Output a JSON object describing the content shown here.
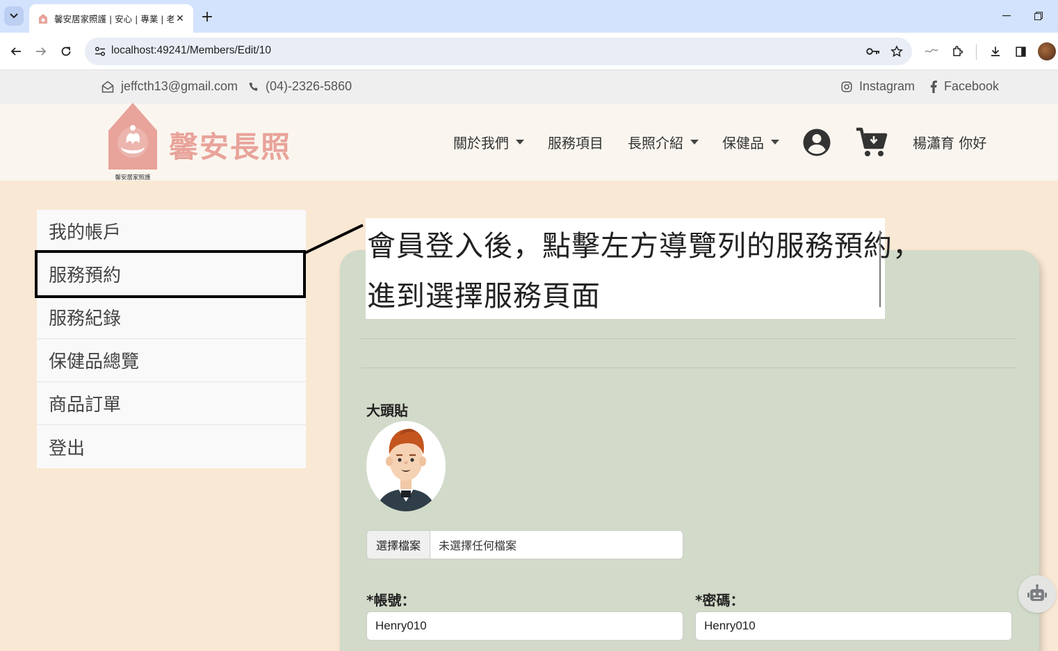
{
  "browser": {
    "tab_title": "馨安居家照護 | 安心 | 專業 | 老人",
    "url": "localhost:49241/Members/Edit/10"
  },
  "topbar": {
    "email": "jeffcth13@gmail.com",
    "phone": "(04)-2326-5860",
    "instagram": "Instagram",
    "facebook": "Facebook"
  },
  "header": {
    "brand": "馨安長照",
    "logo_caption": "馨安居家照護",
    "nav": {
      "about": "關於我們",
      "services": "服務項目",
      "ltc_intro": "長照介紹",
      "health_products": "保健品"
    },
    "greeting": "楊瀟育 你好"
  },
  "sidebar": {
    "items": [
      {
        "label": "我的帳戶"
      },
      {
        "label": "服務預約"
      },
      {
        "label": "服務紀錄"
      },
      {
        "label": "保健品總覽"
      },
      {
        "label": "商品訂單"
      },
      {
        "label": "登出"
      }
    ]
  },
  "callout": {
    "line1": "會員登入後，點擊左方導覽列的服務預約，",
    "line2": "進到選擇服務頁面"
  },
  "form": {
    "avatar_label": "大頭貼",
    "file_button": "選擇檔案",
    "file_status": "未選擇任何檔案",
    "account_label": "*帳號：",
    "account_value": "Henry010",
    "password_label": "*密碼：",
    "password_value": "Henry010"
  },
  "colors": {
    "page_bg": "#f9e8d4",
    "panel_bg": "#d2dac9",
    "brand": "#e8a39a",
    "chrome_tabbar": "#d3e3fd"
  }
}
